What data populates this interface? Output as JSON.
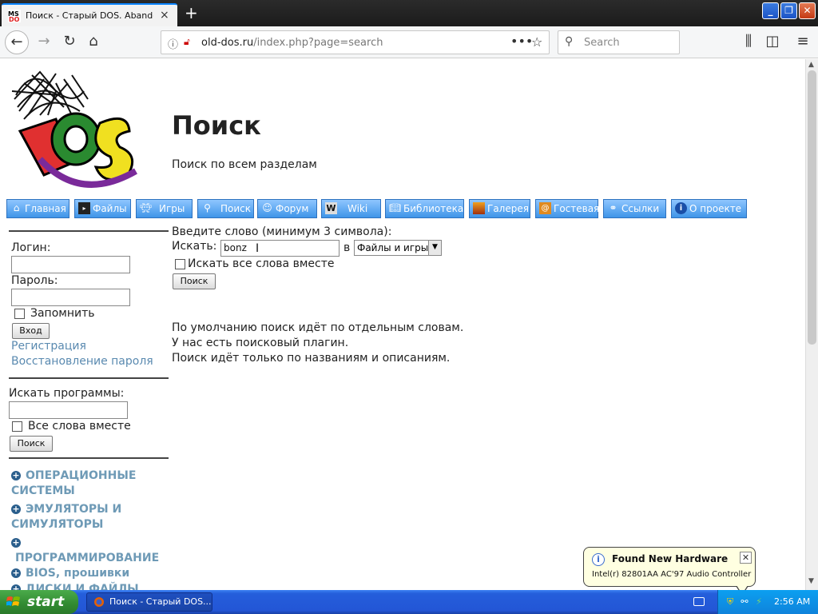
{
  "browser": {
    "tab_title": "Поиск - Старый DOS. Abandonware",
    "tab_close": "×",
    "new_tab": "+",
    "url_domain": "old-dos.ru",
    "url_path": "/index.php?page=search",
    "search_placeholder": "Search"
  },
  "page": {
    "title": "Поиск",
    "subtitle": "Поиск по всем разделам",
    "logo_alt": "MS-DOS"
  },
  "menu": [
    {
      "label": "Главная",
      "icon": "home-icon"
    },
    {
      "label": "Файлы",
      "icon": "terminal-icon"
    },
    {
      "label": "Игры",
      "icon": "invader-icon"
    },
    {
      "label": "Поиск",
      "icon": "magnifier-icon"
    },
    {
      "label": "Форум",
      "icon": "user-icon"
    },
    {
      "label": "Wiki",
      "icon": "wiki-icon"
    },
    {
      "label": "Библиотека",
      "icon": "book-icon"
    },
    {
      "label": "Галерея",
      "icon": "picture-icon"
    },
    {
      "label": "Гостевая",
      "icon": "guestbook-icon"
    },
    {
      "label": "Ссылки",
      "icon": "link-icon"
    },
    {
      "label": "О проекте",
      "icon": "info-icon"
    }
  ],
  "login": {
    "login_label": "Логин:",
    "password_label": "Пароль:",
    "remember_label": "Запомнить",
    "submit_label": "Вход",
    "register_link": "Регистрация",
    "recover_link": "Восстановление пароля"
  },
  "program_search": {
    "label": "Искать программы:",
    "allwords_label": "Все слова вместе",
    "submit_label": "Поиск"
  },
  "categories": [
    "ОПЕРАЦИОННЫЕ СИСТЕМЫ",
    "ЭМУЛЯТОРЫ И СИМУЛЯТОРЫ",
    "ПРОГРАММИРОВАНИЕ",
    "BIOS, прошивки",
    "ДИСКИ И ФАЙЛЫ"
  ],
  "search_form": {
    "hint": "Введите слово (минимум 3 символа):",
    "search_label": "Искать:",
    "query": "bonz",
    "in_label": "в",
    "section_value": "Файлы и игры",
    "allwords_label": "Искать все слова вместе",
    "submit_label": "Поиск"
  },
  "info_lines": [
    "По умолчанию поиск идёт по отдельным словам.",
    "У нас есть поисковый плагин.",
    "Поиск идёт только по названиям и описаниям."
  ],
  "notification": {
    "title": "Found New Hardware",
    "text": "Intel(r) 82801AA AC'97 Audio Controller"
  },
  "taskbar": {
    "start_label": "start",
    "task_label": "Поиск - Старый DOS...",
    "clock": "2:56 AM"
  }
}
